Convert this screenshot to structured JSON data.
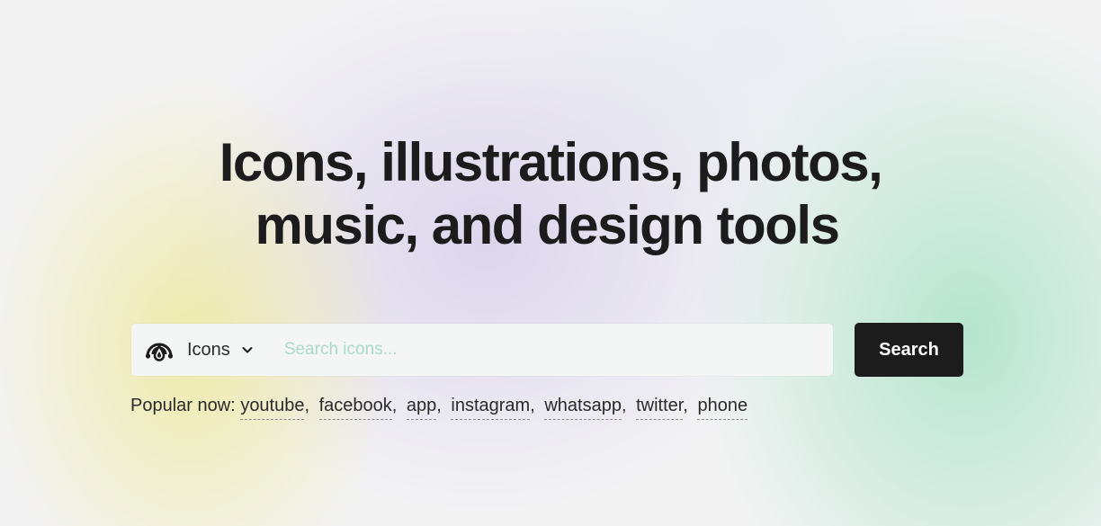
{
  "hero": {
    "headline_line1": "Icons, illustrations, photos,",
    "headline_line2": "music, and design tools"
  },
  "search": {
    "type_icon": "brand-logo-icon",
    "type_label": "Icons",
    "chevron_icon": "chevron-down-icon",
    "placeholder": "Search icons...",
    "button_label": "Search"
  },
  "popular": {
    "label": "Popular now:",
    "items": [
      "youtube",
      "facebook",
      "app",
      "instagram",
      "whatsapp",
      "twitter",
      "phone"
    ]
  },
  "colors": {
    "button_bg": "#1c1c1c",
    "placeholder": "#a9dcc8",
    "text": "#1c1c1c"
  }
}
